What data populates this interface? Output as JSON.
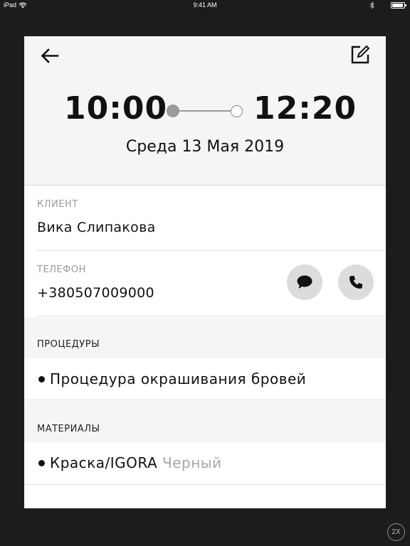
{
  "status_bar": {
    "device": "iPad",
    "time": "9:41 AM",
    "battery_level": 0.95,
    "icons": [
      "wifi-icon",
      "bluetooth-icon",
      "battery-icon"
    ]
  },
  "header": {
    "start_time": "10:00",
    "end_time": "12:20",
    "date": "Среда 13 Мая 2019",
    "icons": {
      "back": "arrow-left-icon",
      "edit": "edit-icon"
    }
  },
  "client": {
    "label": "КЛИЕНТ",
    "value": "Вика Слипакова"
  },
  "phone": {
    "label": "ТЕЛЕФОН",
    "value": "+380507009000",
    "icons": {
      "message": "chat-bubble-icon",
      "call": "phone-icon"
    }
  },
  "procedures": {
    "title": "ПРОЦЕДУРЫ",
    "items": [
      {
        "name": "Процедура окрашивания бровей"
      }
    ]
  },
  "materials": {
    "title": "МАТЕРИАЛЫ",
    "items": [
      {
        "name": "Краска/IGORA",
        "variant": "Черный"
      }
    ]
  },
  "zoom": {
    "label": "2X"
  },
  "colors": {
    "background": "#1c1c1c",
    "card": "#ffffff",
    "header_bg": "#f5f5f5",
    "muted_text": "#9a9a9a",
    "button_bg": "#dcdcdc"
  }
}
